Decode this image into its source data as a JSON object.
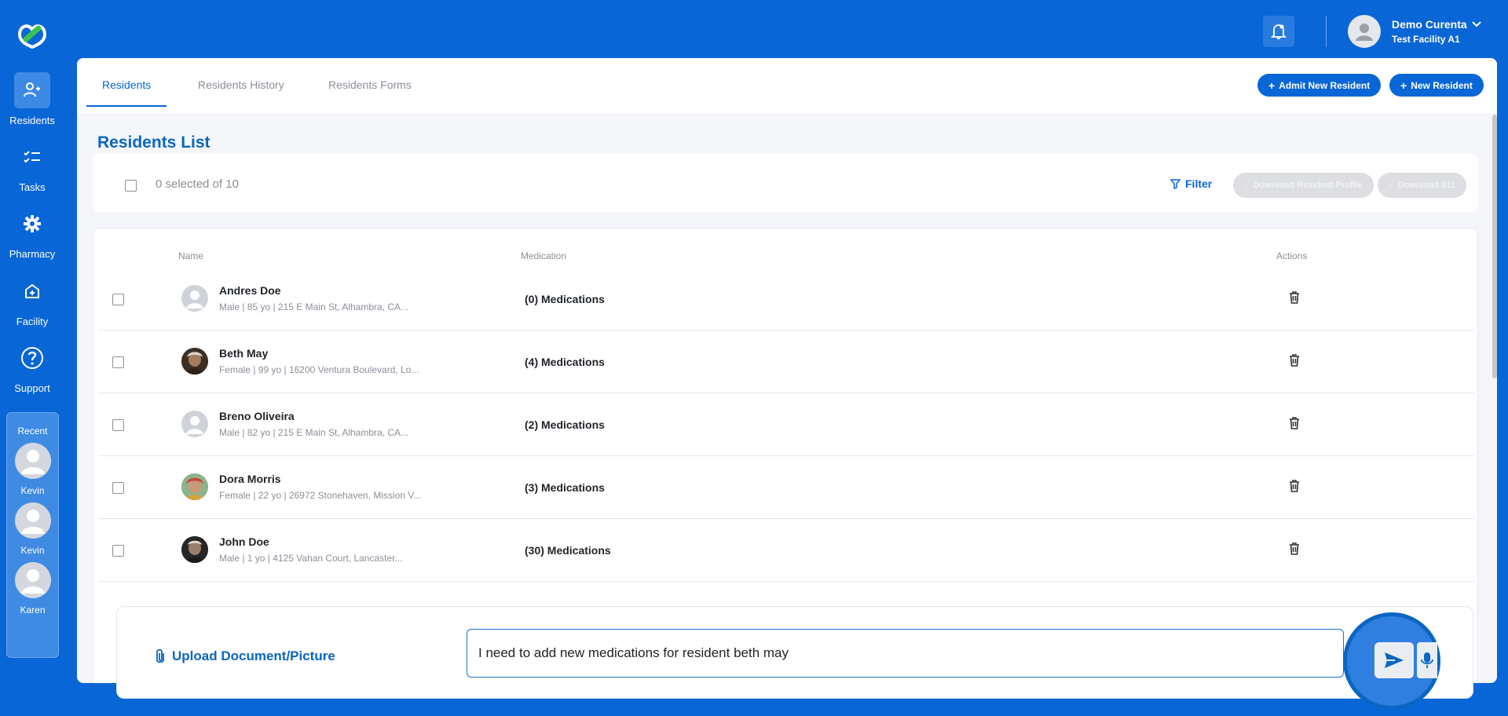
{
  "sidebar": {
    "items": [
      {
        "label": "Residents",
        "icon": "residents-icon",
        "active": true
      },
      {
        "label": "Tasks",
        "icon": "tasks-icon"
      },
      {
        "label": "Pharmacy",
        "icon": "gear-icon"
      },
      {
        "label": "Facility",
        "icon": "facility-icon"
      },
      {
        "label": "Support",
        "icon": "help-icon"
      }
    ],
    "recent": {
      "title": "Recent",
      "items": [
        {
          "name": "Kevin"
        },
        {
          "name": "Kevin"
        },
        {
          "name": "Karen"
        }
      ]
    }
  },
  "header": {
    "user_name": "Demo Curenta",
    "facility": "Test Facility A1"
  },
  "tabs": [
    {
      "label": "Residents",
      "active": true
    },
    {
      "label": "Residents History"
    },
    {
      "label": "Residents Forms"
    }
  ],
  "actions": {
    "admit_label": "Admit New Resident",
    "new_label": "New Resident"
  },
  "page_title": "Residents List",
  "toolbar": {
    "selected_text": "0 selected of 10",
    "filter_label": "Filter",
    "download_profile_label": "Download Resident Profile",
    "download_911_label": "Download 911"
  },
  "table": {
    "headers": {
      "name": "Name",
      "medication": "Medication",
      "actions": "Actions"
    },
    "rows": [
      {
        "name": "Andres Doe",
        "info": "Male | 85 yo | 215 E Main St, Alhambra, CA...",
        "medications": "(0) Medications"
      },
      {
        "name": "Beth May",
        "info": "Female | 99 yo | 16200 Ventura Boulevard, Lo...",
        "medications": "(4) Medications"
      },
      {
        "name": "Breno Oliveira",
        "info": "Male | 82 yo | 215 E Main St, Alhambra, CA...",
        "medications": "(2) Medications"
      },
      {
        "name": "Dora Morris",
        "info": "Female | 22 yo | 26972 Stonehaven, Mission V...",
        "medications": "(3) Medications"
      },
      {
        "name": "John Doe",
        "info": "Male | 1 yo | 4125 Vahan Court, Lancaster...",
        "medications": "(30) Medications"
      }
    ]
  },
  "chat": {
    "upload_label": "Upload Document/Picture",
    "input_value": "I need to add new medications for resident beth may"
  },
  "colors": {
    "brand": "#0866d6",
    "accent": "#0a66c2"
  }
}
